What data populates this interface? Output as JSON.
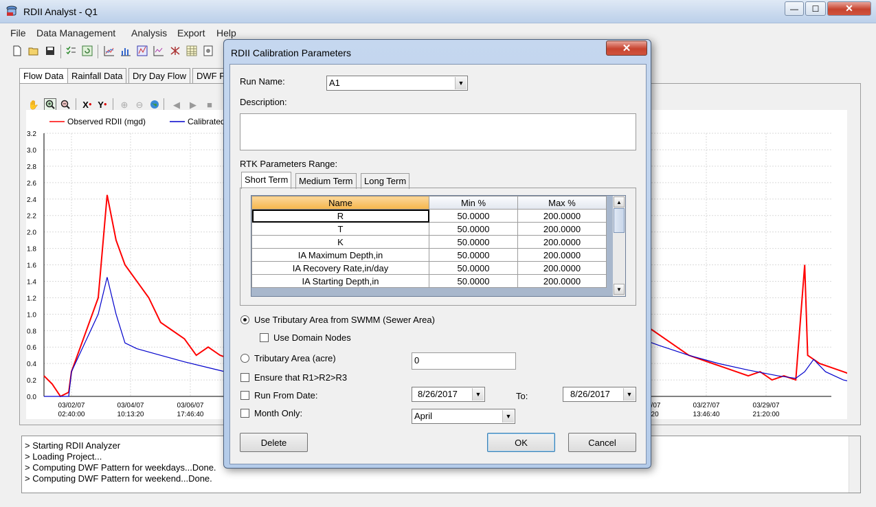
{
  "app": {
    "title": "RDII Analyst - Q1",
    "window_min": "—",
    "window_max": "☐",
    "window_close": "✕"
  },
  "menu": [
    "File",
    "Data Management",
    "Analysis",
    "Export",
    "Help"
  ],
  "toolbar_icons": [
    "new-icon",
    "open-icon",
    "save-icon",
    "checklist-icon",
    "refresh-icon",
    "line-chart-icon",
    "bar-chart-icon",
    "graph-icon",
    "multiline-chart-icon",
    "network-icon",
    "table-icon",
    "settings-icon"
  ],
  "tabs": [
    "Flow Data",
    "Rainfall Data",
    "Dry Day Flow",
    "DWF P"
  ],
  "chart_toolbar_icons": [
    "hand-icon",
    "zoom-in-icon",
    "zoom-out-icon",
    "x-axis-icon",
    "y-axis-icon",
    "zoom-in-disabled-icon",
    "zoom-out-disabled-icon",
    "globe-icon",
    "prev-icon",
    "play-icon",
    "stop-icon"
  ],
  "chart_data": {
    "type": "line",
    "legend": [
      {
        "name": "Observed RDII (mgd)",
        "color": "#ff0000"
      },
      {
        "name": "Calibrated",
        "color": "#0000cc"
      }
    ],
    "legend_placement": "top-left",
    "ylim": [
      0,
      3.2
    ],
    "yticks": [
      "3.2",
      "3.0",
      "2.8",
      "2.6",
      "2.4",
      "2.2",
      "2.0",
      "1.8",
      "1.6",
      "1.4",
      "1.2",
      "1.0",
      "0.8",
      "0.6",
      "0.4",
      "0.2",
      "0.0"
    ],
    "xticks": [
      {
        "date": "03/02/07",
        "time": "02:40:00"
      },
      {
        "date": "03/04/07",
        "time": "10:13:20"
      },
      {
        "date": "03/06/07",
        "time": "17:46:40"
      },
      {
        "date": "03/25/07",
        "time": "6:13:20"
      },
      {
        "date": "03/27/07",
        "time": "13:46:40"
      },
      {
        "date": "03/29/07",
        "time": "21:20:00"
      }
    ],
    "grid": true,
    "series": [
      {
        "name": "Observed RDII (mgd)",
        "color": "#ff0000",
        "left_points": [
          [
            0,
            0.25
          ],
          [
            0.3,
            0.15
          ],
          [
            0.6,
            0.0
          ],
          [
            0.9,
            0.05
          ],
          [
            1.0,
            0.3
          ],
          [
            1.15,
            1.2
          ],
          [
            1.3,
            2.45
          ],
          [
            1.45,
            1.9
          ],
          [
            1.6,
            1.6
          ],
          [
            1.8,
            1.4
          ],
          [
            2.0,
            1.2
          ],
          [
            2.2,
            0.9
          ],
          [
            2.4,
            0.8
          ],
          [
            2.6,
            0.7
          ],
          [
            2.8,
            0.5
          ],
          [
            3.0,
            0.6
          ],
          [
            3.2,
            0.5
          ],
          [
            3.4,
            0.45
          ],
          [
            3.6,
            0.55
          ],
          [
            3.8,
            0.4
          ],
          [
            4.0,
            0.3
          ],
          [
            4.2,
            0.35
          ],
          [
            4.4,
            0.25
          ],
          [
            4.6,
            0.2
          ],
          [
            4.8,
            0.15
          ],
          [
            5.0,
            0.1
          ],
          [
            5.3,
            0.08
          ],
          [
            5.6,
            0.1
          ],
          [
            5.9,
            0.05
          ],
          [
            6.2,
            0.08
          ],
          [
            6.5,
            0.02
          ]
        ],
        "right_points": [
          [
            0,
            1.0
          ],
          [
            0.2,
            0.9
          ],
          [
            0.4,
            0.8
          ],
          [
            0.6,
            0.7
          ],
          [
            0.8,
            0.6
          ],
          [
            1.0,
            0.5
          ],
          [
            1.2,
            0.45
          ],
          [
            1.4,
            0.4
          ],
          [
            1.6,
            0.35
          ],
          [
            1.8,
            0.3
          ],
          [
            2.0,
            0.25
          ],
          [
            2.2,
            0.3
          ],
          [
            2.4,
            0.2
          ],
          [
            2.6,
            0.25
          ],
          [
            2.8,
            0.2
          ],
          [
            2.95,
            1.6
          ],
          [
            3.0,
            0.5
          ],
          [
            3.2,
            0.4
          ],
          [
            3.4,
            0.35
          ],
          [
            3.6,
            0.3
          ],
          [
            3.8,
            0.25
          ],
          [
            4.0,
            0.2
          ],
          [
            4.2,
            0.3
          ],
          [
            4.4,
            0.35
          ],
          [
            4.6,
            0.4
          ],
          [
            4.8,
            0.45
          ],
          [
            5.0,
            0.5
          ],
          [
            5.2,
            0.45
          ],
          [
            5.4,
            0.4
          ]
        ]
      },
      {
        "name": "Calibrated",
        "color": "#0000cc",
        "left_points": [
          [
            0,
            0.0
          ],
          [
            0.5,
            0.0
          ],
          [
            0.9,
            0.0
          ],
          [
            1.0,
            0.3
          ],
          [
            1.15,
            1.0
          ],
          [
            1.3,
            1.45
          ],
          [
            1.45,
            1.0
          ],
          [
            1.6,
            0.65
          ],
          [
            1.8,
            0.58
          ],
          [
            2.2,
            0.5
          ],
          [
            2.6,
            0.42
          ],
          [
            3.0,
            0.35
          ],
          [
            3.4,
            0.28
          ],
          [
            3.8,
            0.22
          ],
          [
            4.2,
            0.17
          ],
          [
            4.6,
            0.12
          ],
          [
            5.0,
            0.08
          ],
          [
            5.4,
            0.06
          ],
          [
            5.8,
            0.04
          ],
          [
            6.2,
            0.03
          ],
          [
            6.5,
            0.02
          ]
        ],
        "right_points": [
          [
            0,
            0.75
          ],
          [
            0.5,
            0.62
          ],
          [
            1.0,
            0.5
          ],
          [
            1.5,
            0.4
          ],
          [
            2.0,
            0.32
          ],
          [
            2.5,
            0.25
          ],
          [
            2.8,
            0.22
          ],
          [
            2.95,
            0.3
          ],
          [
            3.1,
            0.45
          ],
          [
            3.3,
            0.3
          ],
          [
            3.6,
            0.2
          ],
          [
            4.0,
            0.14
          ],
          [
            4.4,
            0.1
          ],
          [
            4.8,
            0.05
          ],
          [
            5.2,
            0.03
          ],
          [
            5.4,
            0.02
          ]
        ]
      }
    ]
  },
  "log": [
    "> Starting RDII Analyzer",
    "> Loading Project...",
    "> Computing DWF Pattern for weekdays...Done.",
    "> Computing DWF Pattern for weekend...Done."
  ],
  "dialog": {
    "title": "RDII Calibration Parameters",
    "close": "✕",
    "run_name_label": "Run Name:",
    "run_name_value": "A1",
    "description_label": "Description:",
    "description_value": "",
    "rtk_label": "RTK Parameters Range:",
    "tabs": [
      "Short Term",
      "Medium Term",
      "Long Term"
    ],
    "grid": {
      "headers": [
        "Name",
        "Min %",
        "Max %"
      ],
      "rows": [
        [
          "R",
          "50.0000",
          "200.0000"
        ],
        [
          "T",
          "50.0000",
          "200.0000"
        ],
        [
          "K",
          "50.0000",
          "200.0000"
        ],
        [
          "IA Maximum Depth,in",
          "50.0000",
          "200.0000"
        ],
        [
          "IA Recovery Rate,in/day",
          "50.0000",
          "200.0000"
        ],
        [
          "IA Starting Depth,in",
          "50.0000",
          "200.0000"
        ]
      ]
    },
    "use_tributary_label": "Use Tributary Area from SWMM (Sewer Area)",
    "use_tributary_checked": true,
    "use_domain_nodes_label": "Use Domain Nodes",
    "tributary_area_label": "Tributary Area (acre)",
    "tributary_area_value": "0",
    "ensure_label": "Ensure that R1>R2>R3",
    "run_from_label": "Run From Date:",
    "run_from_value": "8/26/2017",
    "to_label": "To:",
    "to_value": "8/26/2017",
    "month_only_label": "Month Only:",
    "month_value": "April",
    "delete_label": "Delete",
    "ok_label": "OK",
    "cancel_label": "Cancel"
  }
}
